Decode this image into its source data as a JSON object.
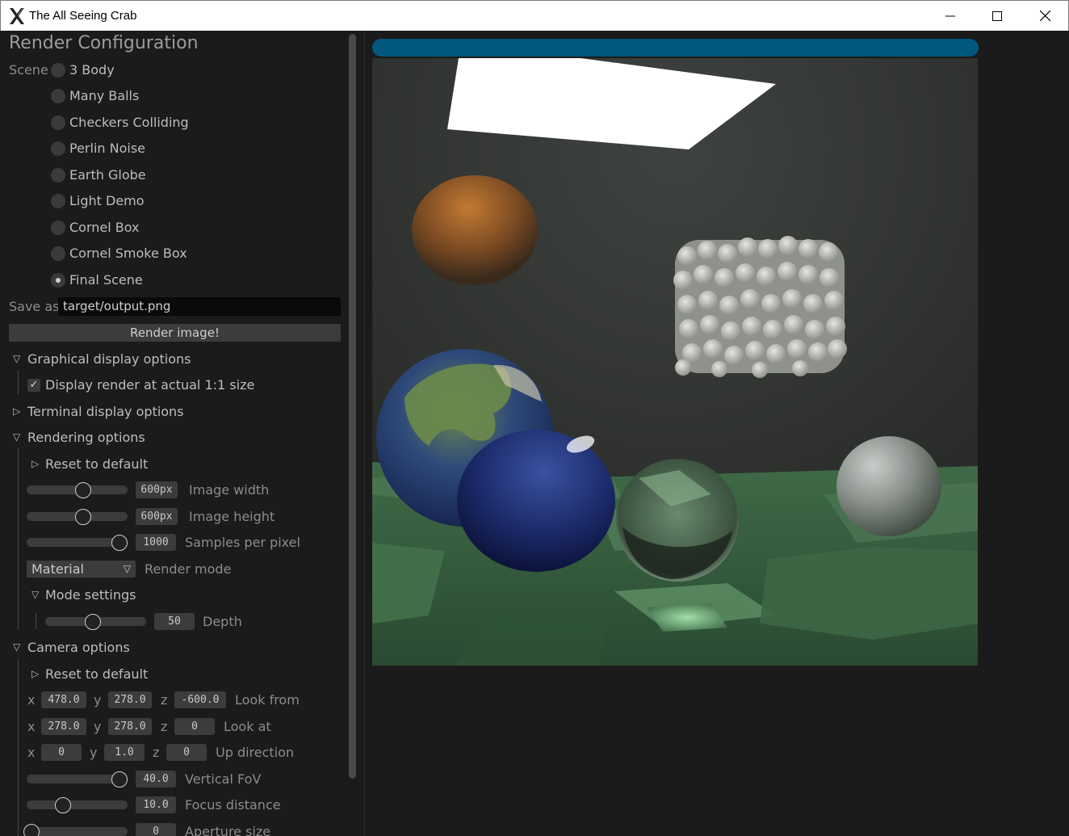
{
  "window": {
    "title": "The All Seeing Crab",
    "controls": [
      "minimize",
      "maximize",
      "close"
    ]
  },
  "panel": {
    "heading": "Render Configuration",
    "scene_label": "Scene",
    "scenes": [
      "3 Body",
      "Many Balls",
      "Checkers Colliding",
      "Perlin Noise",
      "Earth Globe",
      "Light Demo",
      "Cornel Box",
      "Cornel Smoke Box",
      "Final Scene"
    ],
    "selected_scene": "Final Scene",
    "save_as_label": "Save as",
    "save_as_value": "target/output.png",
    "render_button": "Render image!",
    "graphical": {
      "label": "Graphical display options",
      "expanded": true,
      "actual_size_label": "Display render at actual 1:1 size",
      "actual_size_checked": true
    },
    "terminal": {
      "label": "Terminal display options",
      "expanded": false
    },
    "rendering": {
      "label": "Rendering options",
      "expanded": true,
      "reset_label": "Reset to default",
      "image_width": {
        "value": "600px",
        "label": "Image width",
        "fraction": 0.59
      },
      "image_height": {
        "value": "600px",
        "label": "Image height",
        "fraction": 0.59
      },
      "samples": {
        "value": "1000",
        "label": "Samples per pixel",
        "fraction": 1.0
      },
      "render_mode": {
        "value": "Material",
        "label": "Render mode"
      },
      "mode_settings_label": "Mode settings",
      "depth": {
        "value": "50",
        "label": "Depth",
        "fraction": 0.49
      }
    },
    "camera": {
      "label": "Camera options",
      "expanded": true,
      "reset_label": "Reset to default",
      "axis_x": "x",
      "axis_y": "y",
      "axis_z": "z",
      "look_from": {
        "x": "478.0",
        "y": "278.0",
        "z": "-600.0",
        "label": "Look from"
      },
      "look_at": {
        "x": "278.0",
        "y": "278.0",
        "z": "0",
        "label": "Look at"
      },
      "up": {
        "x": "0",
        "y": "1.0",
        "z": "0",
        "label": "Up direction"
      },
      "vfov": {
        "value": "40.0",
        "label": "Vertical FoV",
        "fraction": 1.0
      },
      "focus": {
        "value": "10.0",
        "label": "Focus distance",
        "fraction": 0.36
      },
      "aperture": {
        "value": "0",
        "label": "Aperture size",
        "fraction": 0.0
      }
    }
  },
  "render": {
    "progress": 1.0,
    "progress_color": "#00587f"
  }
}
